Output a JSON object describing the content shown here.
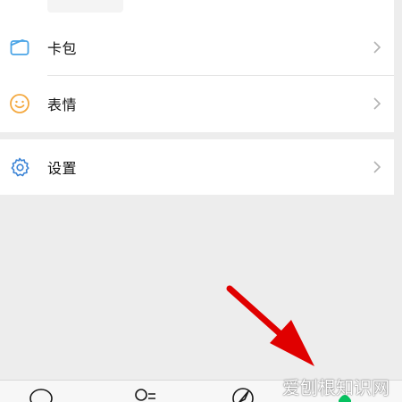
{
  "menu": {
    "items": [
      {
        "label": "卡包",
        "icon": "card-wallet-icon"
      },
      {
        "label": "表情",
        "icon": "smiley-icon"
      }
    ],
    "settings": {
      "label": "设置",
      "icon": "gear-icon"
    }
  },
  "tabbar": {
    "tabs": [
      {
        "icon": "chat-bubble-icon"
      },
      {
        "icon": "contacts-icon"
      },
      {
        "icon": "compass-icon"
      },
      {
        "icon": "me-icon",
        "active": true
      }
    ]
  },
  "watermark": {
    "text": "爱刨根知识网"
  },
  "colors": {
    "background": "#ededed",
    "card": "#ffffff",
    "card_icon": "#4aa4e6",
    "smiley_icon": "#f4a940",
    "gear_icon": "#3d85d6",
    "active_tab": "#07c160",
    "arrow": "#e00000"
  }
}
